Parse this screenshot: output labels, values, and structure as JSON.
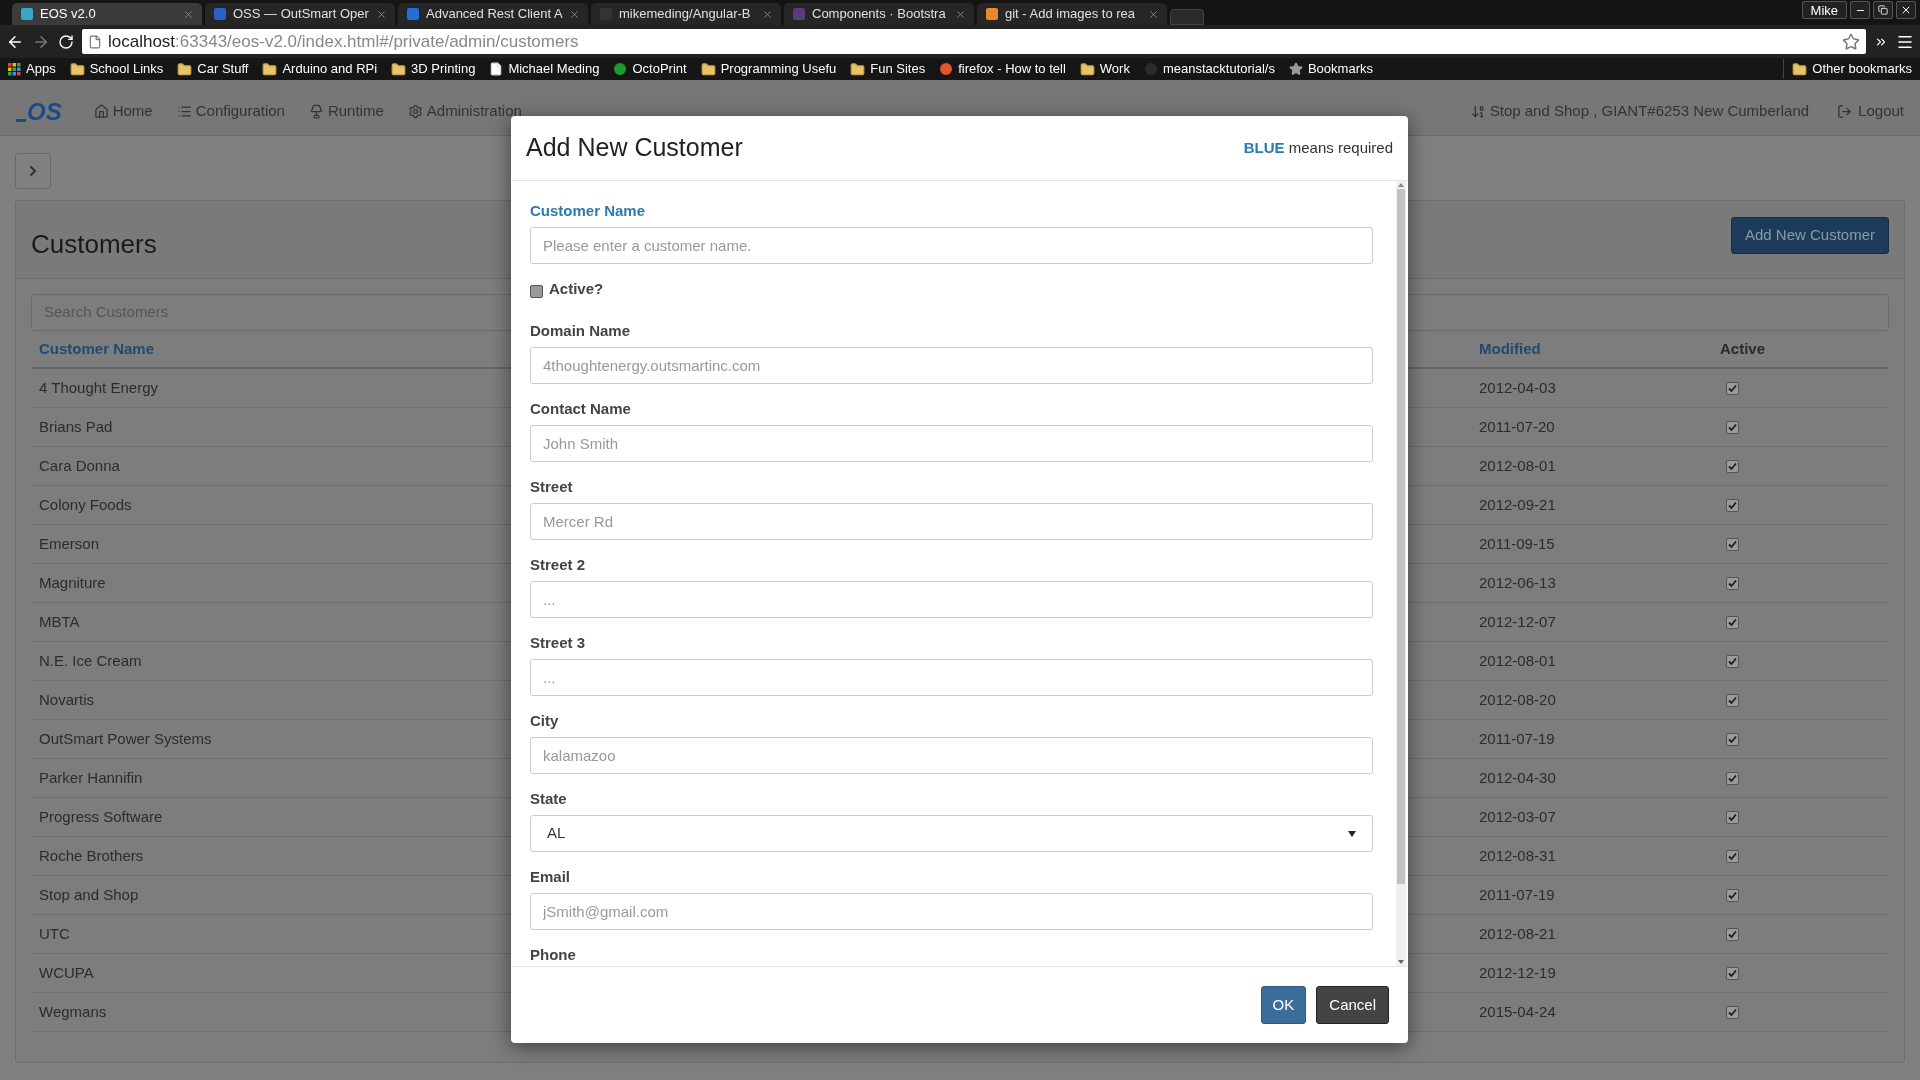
{
  "browser": {
    "tabs": [
      {
        "title": "EOS v2.0",
        "selected": true,
        "color": "#3aa7c9"
      },
      {
        "title": "OSS — OutSmart Oper",
        "selected": false,
        "color": "#2b5fc4"
      },
      {
        "title": "Advanced Rest Client A",
        "selected": false,
        "color": "#1f6fd6"
      },
      {
        "title": "mikemeding/Angular-B",
        "selected": false,
        "color": "#333333"
      },
      {
        "title": "Components · Bootstra",
        "selected": false,
        "color": "#563d7c"
      },
      {
        "title": "git - Add images to rea",
        "selected": false,
        "color": "#e8892c"
      }
    ],
    "user": "Mike",
    "address": {
      "host": "localhost",
      "path": ":63343/eos-v2.0/index.html#/private/admin/customers"
    },
    "bookmarks": [
      {
        "label": "Apps",
        "kind": "apps"
      },
      {
        "label": "School Links",
        "kind": "folder"
      },
      {
        "label": "Car Stuff",
        "kind": "folder"
      },
      {
        "label": "Arduino and RPi",
        "kind": "folder"
      },
      {
        "label": "3D Printing",
        "kind": "folder"
      },
      {
        "label": "Michael Meding",
        "kind": "page"
      },
      {
        "label": "OctoPrint",
        "kind": "site",
        "color": "#1c9c2c"
      },
      {
        "label": "Programming Usefu",
        "kind": "folder"
      },
      {
        "label": "Fun Sites",
        "kind": "folder"
      },
      {
        "label": "firefox - How to tell",
        "kind": "site",
        "color": "#e2542a"
      },
      {
        "label": "Work",
        "kind": "folder"
      },
      {
        "label": "meanstacktutorial/s",
        "kind": "site",
        "color": "#2a2a2a"
      },
      {
        "label": "Bookmarks",
        "kind": "star"
      }
    ],
    "other_bookmarks": "Other bookmarks"
  },
  "navbar": {
    "logo": "OS",
    "items": [
      {
        "label": "Home",
        "kind": "home"
      },
      {
        "label": "Configuration",
        "kind": "list"
      },
      {
        "label": "Runtime",
        "kind": "lamp"
      },
      {
        "label": "Administration",
        "kind": "gear"
      }
    ],
    "site": "Stop and Shop , GIANT#6253 New Cumberland",
    "logout": "Logout"
  },
  "page": {
    "title": "Customers",
    "add_button": "Add New Customer",
    "search": {
      "placeholder": "Search Customers"
    },
    "table": {
      "columns": [
        {
          "label": "Customer Name",
          "sortable": true
        },
        {
          "label": "Modified",
          "sortable": true
        },
        {
          "label": "Active",
          "sortable": false
        }
      ],
      "rows": [
        {
          "name": "4 Thought Energy",
          "modified": "2012-04-03",
          "active": true
        },
        {
          "name": "Brians Pad",
          "modified": "2011-07-20",
          "active": true
        },
        {
          "name": "Cara Donna",
          "modified": "2012-08-01",
          "active": true
        },
        {
          "name": "Colony Foods",
          "modified": "2012-09-21",
          "active": true
        },
        {
          "name": "Emerson",
          "modified": "2011-09-15",
          "active": true
        },
        {
          "name": "Magniture",
          "modified": "2012-06-13",
          "active": true
        },
        {
          "name": "MBTA",
          "modified": "2012-12-07",
          "active": true
        },
        {
          "name": "N.E. Ice Cream",
          "modified": "2012-08-01",
          "active": true
        },
        {
          "name": "Novartis",
          "modified": "2012-08-20",
          "active": true
        },
        {
          "name": "OutSmart Power Systems",
          "modified": "2011-07-19",
          "active": true
        },
        {
          "name": "Parker Hannifin",
          "modified": "2012-04-30",
          "active": true
        },
        {
          "name": "Progress Software",
          "modified": "2012-03-07",
          "active": true
        },
        {
          "name": "Roche Brothers",
          "modified": "2012-08-31",
          "active": true
        },
        {
          "name": "Stop and Shop",
          "modified": "2011-07-19",
          "active": true
        },
        {
          "name": "UTC",
          "modified": "2012-08-21",
          "active": true
        },
        {
          "name": "WCUPA",
          "modified": "2012-12-19",
          "active": true
        },
        {
          "name": "Wegmans",
          "modified": "2015-04-24",
          "active": true
        }
      ]
    }
  },
  "dialog": {
    "title": "Add New Customer",
    "hint": "**BLUE** means required",
    "fields": [
      {
        "label": "Customer Name",
        "kind": "text",
        "required": true,
        "placeholder": "Please enter a customer name."
      },
      {
        "label": "Active?",
        "kind": "checkbox",
        "required": false,
        "checked": false
      },
      {
        "label": "Domain Name",
        "kind": "text",
        "required": false,
        "placeholder": "4thoughtenergy.outsmartinc.com"
      },
      {
        "label": "Contact Name",
        "kind": "text",
        "required": false,
        "placeholder": "John Smith"
      },
      {
        "label": "Street",
        "kind": "text",
        "required": false,
        "placeholder": "Mercer Rd"
      },
      {
        "label": "Street 2",
        "kind": "text",
        "required": false,
        "placeholder": "..."
      },
      {
        "label": "Street 3",
        "kind": "text",
        "required": false,
        "placeholder": "..."
      },
      {
        "label": "City",
        "kind": "text",
        "required": false,
        "placeholder": "kalamazoo"
      },
      {
        "label": "State",
        "kind": "select",
        "required": false,
        "value": "AL"
      },
      {
        "label": "Email",
        "kind": "text",
        "required": false,
        "placeholder": "jSmith@gmail.com"
      },
      {
        "label": "Phone",
        "kind": "text",
        "required": false
      }
    ],
    "buttons": [
      {
        "label": "OK",
        "kind": "primary"
      },
      {
        "label": "Cancel",
        "kind": "secondary"
      }
    ]
  }
}
